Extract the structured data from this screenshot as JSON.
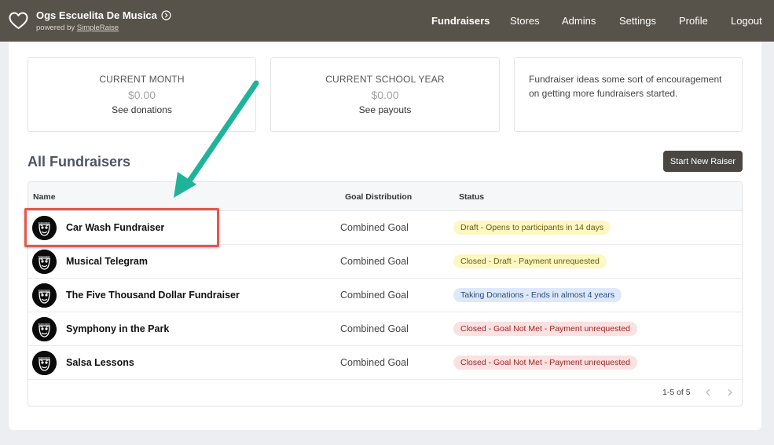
{
  "header": {
    "title": "Ogs Escuelita De Musica",
    "powered_prefix": "powered by",
    "powered_link": "SimpleRaise",
    "nav": [
      {
        "label": "Fundraisers",
        "active": true
      },
      {
        "label": "Stores",
        "active": false
      },
      {
        "label": "Admins",
        "active": false
      },
      {
        "label": "Settings",
        "active": false
      },
      {
        "label": "Profile",
        "active": false
      },
      {
        "label": "Logout",
        "active": false
      }
    ]
  },
  "stats": {
    "current_month": {
      "label": "CURRENT MONTH",
      "value": "$0.00",
      "link": "See donations"
    },
    "current_school_year": {
      "label": "CURRENT SCHOOL YEAR",
      "value": "$0.00",
      "link": "See payouts"
    },
    "note": "Fundraiser ideas some sort of encouragement on getting more fundraisers started."
  },
  "fundraisers": {
    "title": "All Fundraisers",
    "new_button": "Start New Raiser",
    "columns": {
      "name": "Name",
      "goal": "Goal Distribution",
      "status": "Status"
    },
    "rows": [
      {
        "name": "Car Wash Fundraiser",
        "goal": "Combined Goal",
        "status": "Draft - Opens to participants in 14 days",
        "status_color": "yellow"
      },
      {
        "name": "Musical Telegram",
        "goal": "Combined Goal",
        "status": "Closed - Draft - Payment unrequested",
        "status_color": "yellow"
      },
      {
        "name": "The Five Thousand Dollar Fundraiser",
        "goal": "Combined Goal",
        "status": "Taking Donations - Ends in almost 4 years",
        "status_color": "blue"
      },
      {
        "name": "Symphony in the Park",
        "goal": "Combined Goal",
        "status": "Closed - Goal Not Met - Payment unrequested",
        "status_color": "red"
      },
      {
        "name": "Salsa Lessons",
        "goal": "Combined Goal",
        "status": "Closed - Goal Not Met - Payment unrequested",
        "status_color": "red"
      }
    ],
    "pagination": "1-5 of 5"
  },
  "colors": {
    "topbar": "#57534a",
    "highlight": "#e5574b",
    "arrow": "#1fb39a"
  },
  "icons": {
    "logo": "heart-outline-icon",
    "title_arrow": "circle-arrow-right-icon",
    "pager_prev": "chevron-left-icon",
    "pager_next": "chevron-right-icon"
  }
}
